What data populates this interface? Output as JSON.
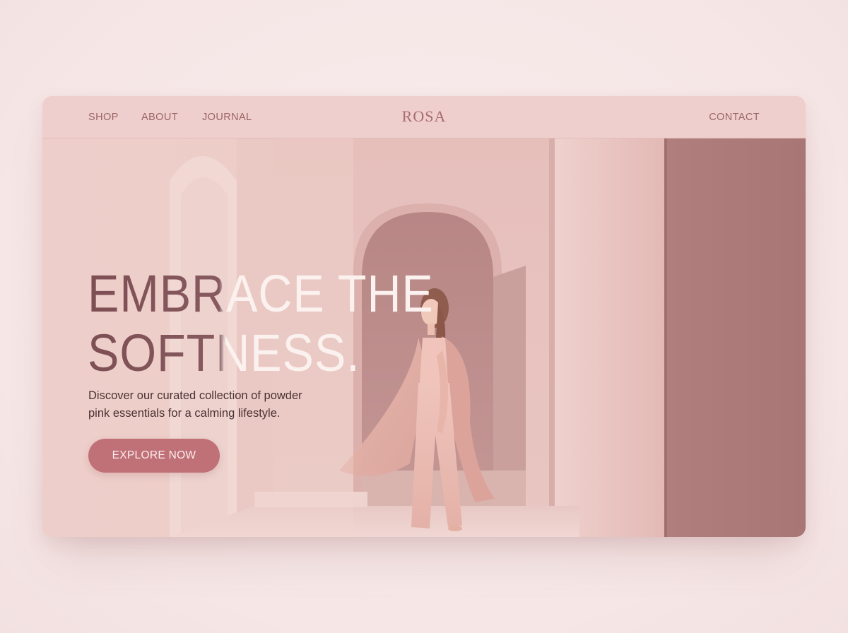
{
  "nav": {
    "links": [
      "SHOP",
      "ABOUT",
      "JOURNAL"
    ],
    "logo": "ROSA",
    "contact": "CONTACT"
  },
  "hero": {
    "headline_line1": "EMBRACE THE",
    "headline_line2": "SOFTNESS.",
    "subtext_line1": "Discover our curated collection of powder",
    "subtext_line2": "pink essentials for a calming lifestyle.",
    "cta_label": "EXPLORE NOW",
    "image_subject": "woman in pink flowing outfit walking through pink arched corridor"
  },
  "colors": {
    "page_bg": "#f8eaea",
    "nav_bg": "#efcfcd",
    "nav_text": "#9a6466",
    "logo": "#a86c70",
    "headline_dark": "#7d4f55",
    "headline_light": "#fbf1ee",
    "cta_bg": "#c07077",
    "cta_text": "#fbeeee"
  }
}
